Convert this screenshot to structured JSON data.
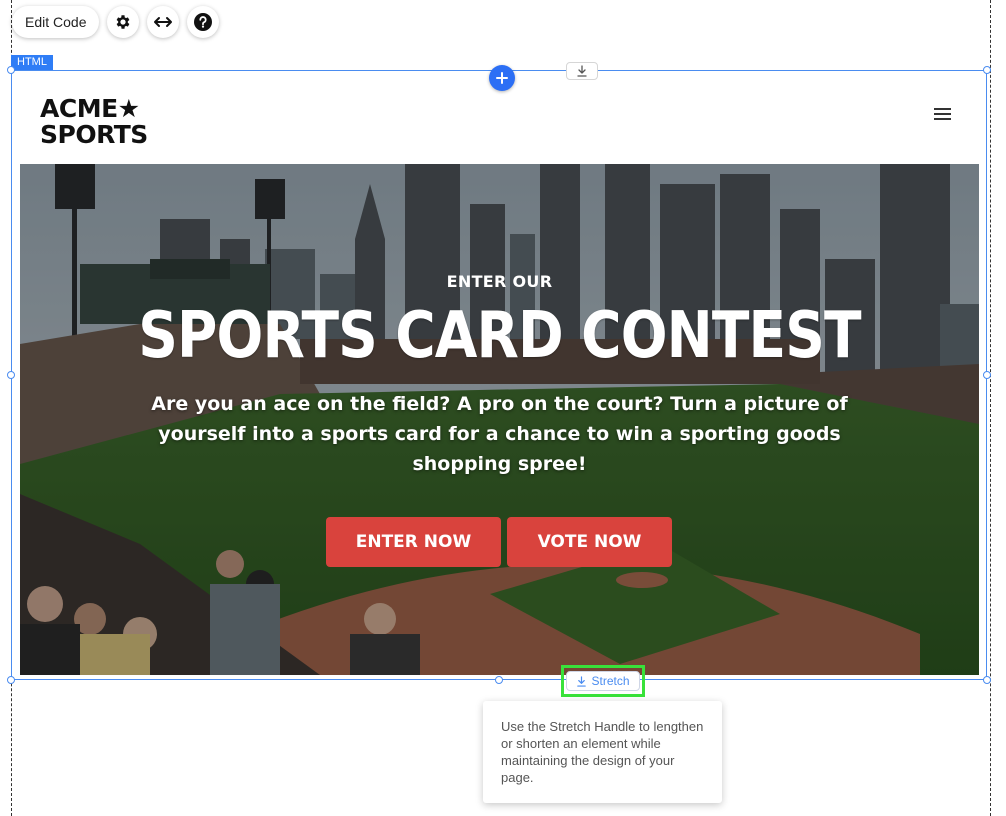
{
  "editor": {
    "toolbar": {
      "edit_code_label": "Edit Code",
      "settings_icon": "gear-icon",
      "stretch_icon": "horizontal-arrows-icon",
      "help_icon": "help-icon"
    },
    "element_tag": "HTML",
    "add_icon": "plus-icon",
    "top_stretch_icon": "download-arrow-icon",
    "bottom_stretch_label": "Stretch",
    "tooltip_text": "Use the Stretch Handle to lengthen or shorten an element while maintaining the design of your page.",
    "colors": {
      "selection": "#4a8cf0",
      "add_button": "#2c6ff5",
      "highlight": "#39e23a"
    }
  },
  "site": {
    "logo": {
      "line1": "ACME★",
      "line2": "SPORTS"
    },
    "menu_icon": "hamburger-icon",
    "hero": {
      "kicker": "ENTER OUR",
      "title": "SPORTS CARD CONTEST",
      "subtitle": "Are you an ace on the field? A pro on the court? Turn a picture of yourself into a sports card for a chance to win a sporting goods shopping spree!",
      "buttons": {
        "enter": "ENTER NOW",
        "vote": "VOTE NOW"
      },
      "background": "baseball-stadium-photo",
      "colors": {
        "cta": "#d9433d"
      }
    }
  }
}
